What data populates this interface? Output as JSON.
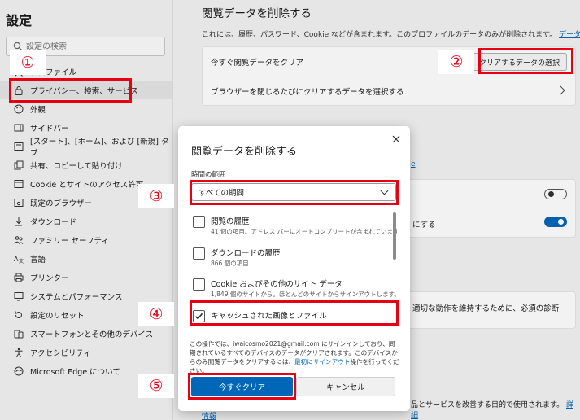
{
  "sidebar": {
    "title": "設定",
    "search_placeholder": "設定の検索",
    "items": [
      {
        "label": "プロファイル",
        "icon": "profile-icon"
      },
      {
        "label": "プライバシー、検索、サービス",
        "icon": "lock-icon"
      },
      {
        "label": "外観",
        "icon": "palette-icon"
      },
      {
        "label": "サイドバー",
        "icon": "sidebar-icon"
      },
      {
        "label": "[スタート]、[ホーム]、および [新規] タブ",
        "icon": "home-icon"
      },
      {
        "label": "共有、コピーして貼り付け",
        "icon": "share-icon"
      },
      {
        "label": "Cookie とサイトのアクセス許可",
        "icon": "cookie-icon"
      },
      {
        "label": "既定のブラウザー",
        "icon": "browser-icon"
      },
      {
        "label": "ダウンロード",
        "icon": "download-icon"
      },
      {
        "label": "ファミリー セーフティ",
        "icon": "family-icon"
      },
      {
        "label": "言語",
        "icon": "language-icon"
      },
      {
        "label": "プリンター",
        "icon": "printer-icon"
      },
      {
        "label": "システムとパフォーマンス",
        "icon": "system-icon"
      },
      {
        "label": "設定のリセット",
        "icon": "reset-icon"
      },
      {
        "label": "スマートフォンとその他のデバイス",
        "icon": "phone-icon"
      },
      {
        "label": "アクセシビリティ",
        "icon": "accessibility-icon"
      },
      {
        "label": "Microsoft Edge について",
        "icon": "edge-icon"
      }
    ]
  },
  "main": {
    "title": "閲覧データを削除する",
    "description": "これには、履歴、パスワード、Cookie などが含まれます。このプロファイルのデータのみが削除されます。",
    "manage_data_link": "データの管理",
    "clear_now_row": "今すぐ閲覧データをクリア",
    "choose_button": "クリアするデータの選択",
    "on_close_row": "ブラウザーを閉じるたびにクリアするデータを選択する",
    "partial_row_1": "にする",
    "partial_row_2": "適切な動作を維持するために、必須の診断",
    "partial_row_3": "品とサービスを改善する目的で使用されます。",
    "partial_link": "詳細",
    "partial_link_2": "情報"
  },
  "dialog": {
    "title": "閲覧データを削除する",
    "range_label": "時間の範囲",
    "range_value": "すべての期間",
    "options": [
      {
        "title": "閲覧の履歴",
        "subtitle": "41 個の項目。アドレス バーにオートコンプリートが含まれています。",
        "checked": false
      },
      {
        "title": "ダウンロードの履歴",
        "subtitle": "866 個の項目",
        "checked": false
      },
      {
        "title": "Cookie およびその他のサイト データ",
        "subtitle": "1,849 個のサイトから。ほとんどのサイトからサインアウトします。",
        "checked": false
      },
      {
        "title": "キャッシュされた画像とファイル",
        "subtitle": "",
        "checked": true
      }
    ],
    "note_part1": "この操作では、iwaicosmo2021@gmail.com にサインインしており、同期されているすべてのデバイスのデータがクリアされます。このデバイスからのみ閲覧データをクリアするには、",
    "note_link": "最初にサインアウト",
    "note_part2": "操作を行ってください。",
    "clear_button": "今すぐクリア",
    "cancel_button": "キャンセル"
  },
  "annotations": {
    "labels": [
      "①",
      "②",
      "③",
      "④",
      "⑤"
    ],
    "color": "#e60012"
  },
  "colors": {
    "accent": "#0067b8",
    "toggle_on": "#0067b8"
  }
}
